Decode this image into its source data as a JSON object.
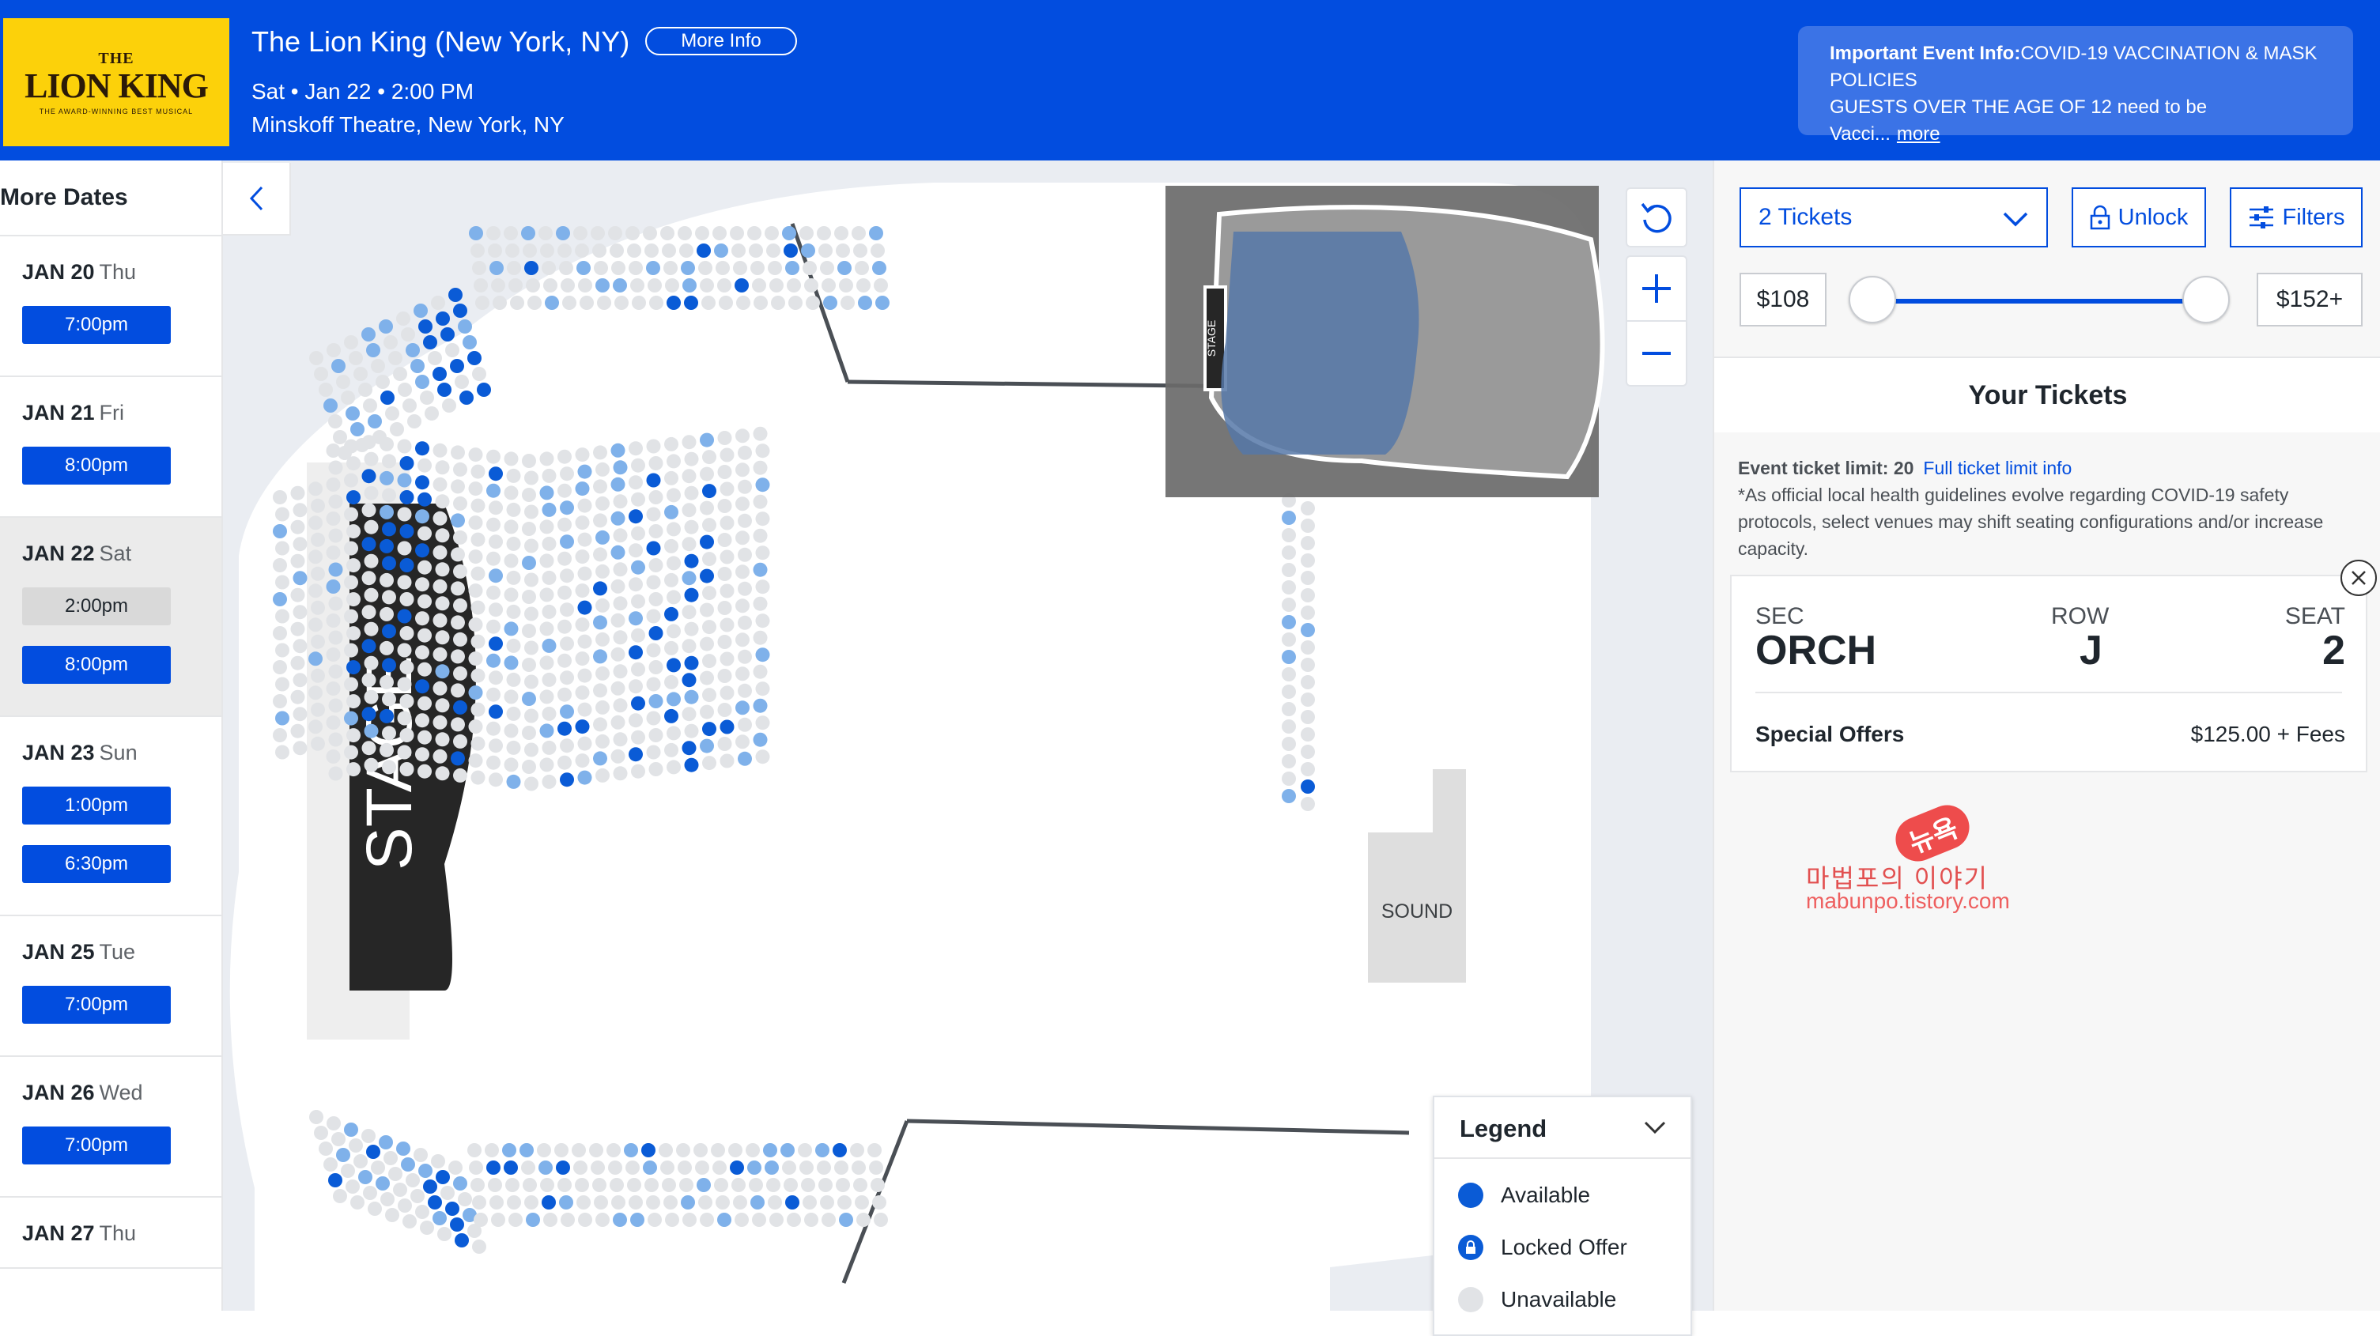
{
  "event": {
    "logo": {
      "line1": "THE",
      "line2": "LION KING",
      "tagline": "THE AWARD-WINNING BEST MUSICAL"
    },
    "title": "The Lion King (New York, NY)",
    "more_info_label": "More Info",
    "datetime": "Sat • Jan 22 • 2:00 PM",
    "venue": "Minskoff Theatre, New York, NY"
  },
  "important": {
    "label": "Important Event Info:",
    "headline": "COVID-19 VACCINATION & MASK",
    "line2": "POLICIES",
    "line3": "GUESTS OVER THE AGE OF 12 need to be Vacci...",
    "more_label": "more"
  },
  "sidebar": {
    "title": "More Dates",
    "collapse_icon": "chevron-left-icon",
    "dates": [
      {
        "date": "JAN 20",
        "dow": "Thu",
        "times": [
          "7:00pm"
        ]
      },
      {
        "date": "JAN 21",
        "dow": "Fri",
        "times": [
          "8:00pm"
        ]
      },
      {
        "date": "JAN 22",
        "dow": "Sat",
        "times": [
          "2:00pm",
          "8:00pm"
        ],
        "selected": true
      },
      {
        "date": "JAN 23",
        "dow": "Sun",
        "times": [
          "1:00pm",
          "6:30pm"
        ]
      },
      {
        "date": "JAN 25",
        "dow": "Tue",
        "times": [
          "7:00pm"
        ]
      },
      {
        "date": "JAN 26",
        "dow": "Wed",
        "times": [
          "7:00pm"
        ]
      },
      {
        "date": "JAN 27",
        "dow": "Thu",
        "times": []
      }
    ]
  },
  "map": {
    "stage_label": "STAGE",
    "sound_label": "SOUND",
    "minimap_stage_label": "STAGE",
    "controls": {
      "reset": "rotate-ccw-icon",
      "zoom_in": "plus-icon",
      "zoom_out": "minus-icon"
    }
  },
  "legend": {
    "title": "Legend",
    "items": [
      {
        "label": "Available",
        "color": "#0a5bd6"
      },
      {
        "label": "Locked Offer",
        "color": "#0a5bd6"
      },
      {
        "label": "Unavailable",
        "color": "#e1e3e6"
      }
    ]
  },
  "tickets_panel": {
    "quantity": "2 Tickets",
    "unlock_label": "Unlock",
    "filters_label": "Filters",
    "price_min": "$108",
    "price_max": "$152+",
    "heading": "Your Tickets",
    "limit_label": "Event ticket limit: 20",
    "limit_link": "Full ticket limit info",
    "notice": "*As official local health guidelines evolve regarding COVID-19 safety protocols, select venues may shift seating configurations and/or increase capacity.",
    "ticket": {
      "sec_label": "SEC",
      "sec": "ORCH",
      "row_label": "ROW",
      "row": "J",
      "seat_label": "SEAT",
      "seat": "2",
      "offer": "Special Offers",
      "price": "$125.00 + Fees"
    },
    "close_icon": "close-icon"
  },
  "watermark": {
    "badge": "뉴욕",
    "line1": "마법포의 이야기",
    "line2": "mabunpo.tistory.com"
  },
  "colors": {
    "brand": "#024ddf",
    "available": "#0a5bd6",
    "locked": "#7fb1ea",
    "unavailable": "#e1e3e6"
  }
}
